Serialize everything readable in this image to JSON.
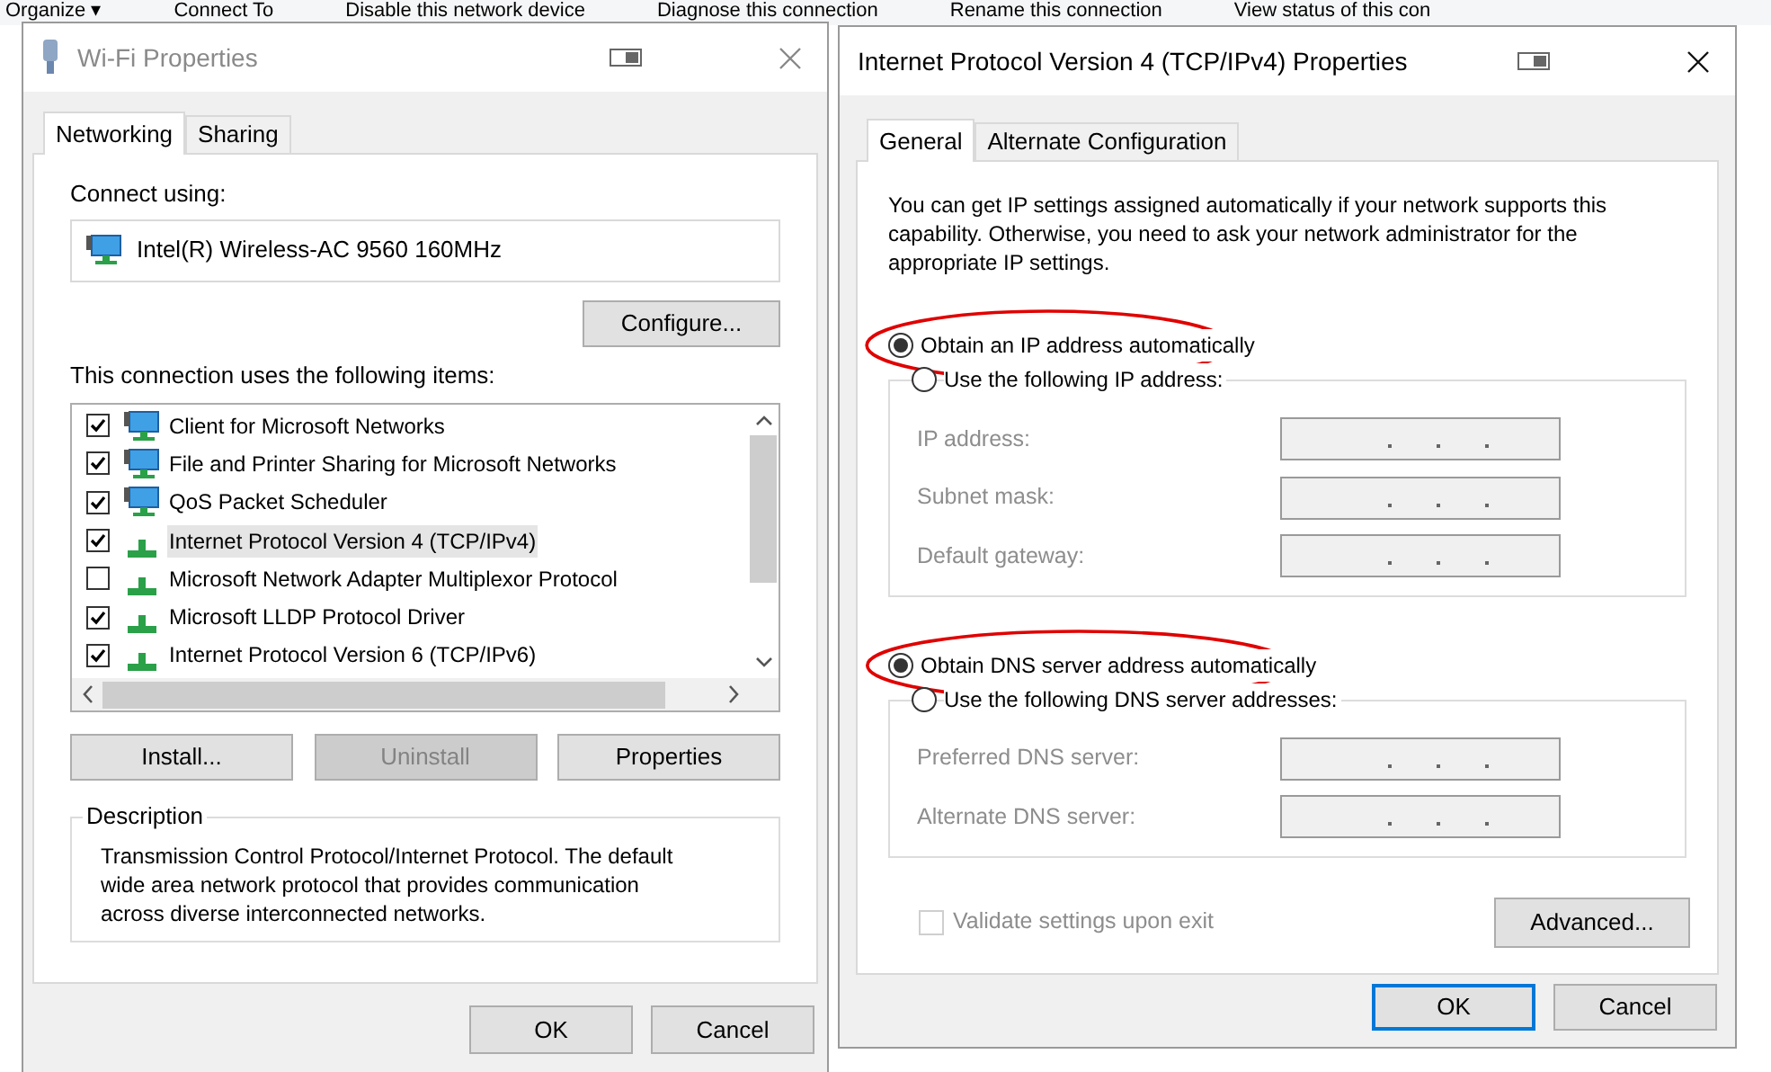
{
  "explorer_toolbar": [
    "Organize ▾",
    "Connect To",
    "Disable this network device",
    "Diagnose this connection",
    "Rename this connection",
    "View status of this con"
  ],
  "wifi_dialog": {
    "title": "Wi-Fi Properties",
    "tabs": [
      {
        "label": "Networking",
        "selected": true
      },
      {
        "label": "Sharing",
        "selected": false
      }
    ],
    "connect_using_label": "Connect using:",
    "adapter": "Intel(R) Wireless-AC 9560 160MHz",
    "configure_button": "Configure...",
    "items_label": "This connection uses the following items:",
    "items": [
      {
        "label": "Client for Microsoft Networks",
        "checked": true,
        "selected": false,
        "kind": "client"
      },
      {
        "label": "File and Printer Sharing for Microsoft Networks",
        "checked": true,
        "selected": false,
        "kind": "client"
      },
      {
        "label": "QoS Packet Scheduler",
        "checked": true,
        "selected": false,
        "kind": "client"
      },
      {
        "label": "Internet Protocol Version 4 (TCP/IPv4)",
        "checked": true,
        "selected": true,
        "kind": "protocol"
      },
      {
        "label": "Microsoft Network Adapter Multiplexor Protocol",
        "checked": false,
        "selected": false,
        "kind": "protocol"
      },
      {
        "label": "Microsoft LLDP Protocol Driver",
        "checked": true,
        "selected": false,
        "kind": "protocol"
      },
      {
        "label": "Internet Protocol Version 6 (TCP/IPv6)",
        "checked": true,
        "selected": false,
        "kind": "protocol"
      }
    ],
    "buttons": [
      {
        "label": "Install...",
        "disabled": false
      },
      {
        "label": "Uninstall",
        "disabled": true
      },
      {
        "label": "Properties",
        "disabled": false
      }
    ],
    "description_label": "Description",
    "description": "Transmission Control Protocol/Internet Protocol. The default wide area network protocol that provides communication across diverse interconnected networks.",
    "footer_buttons": [
      {
        "label": "OK",
        "default": false
      },
      {
        "label": "Cancel",
        "default": false
      }
    ]
  },
  "ipv4_dialog": {
    "title": "Internet Protocol Version 4 (TCP/IPv4) Properties",
    "tabs": [
      {
        "label": "General",
        "selected": true
      },
      {
        "label": "Alternate Configuration",
        "selected": false
      }
    ],
    "intro": "You can get IP settings assigned automatically if your network supports this capability. Otherwise, you need to ask your network administrator for the appropriate IP settings.",
    "sections": [
      {
        "auto": {
          "label": "Obtain an IP address automatically",
          "selected": true,
          "circled": true
        },
        "manual": {
          "label": "Use the following IP address:",
          "selected": false
        },
        "fields": [
          {
            "label": "IP address:"
          },
          {
            "label": "Subnet mask:"
          },
          {
            "label": "Default gateway:"
          }
        ],
        "disabled": true
      },
      {
        "auto": {
          "label": "Obtain DNS server address automatically",
          "selected": true,
          "circled": true
        },
        "manual": {
          "label": "Use the following DNS server addresses:",
          "selected": false
        },
        "fields": [
          {
            "label": "Preferred DNS server:"
          },
          {
            "label": "Alternate DNS server:"
          }
        ],
        "disabled": true
      }
    ],
    "validate": {
      "label": "Validate settings upon exit",
      "checked": false,
      "disabled": true
    },
    "advanced_button": "Advanced...",
    "footer_buttons": [
      {
        "label": "OK",
        "default": true
      },
      {
        "label": "Cancel",
        "default": false
      }
    ]
  }
}
